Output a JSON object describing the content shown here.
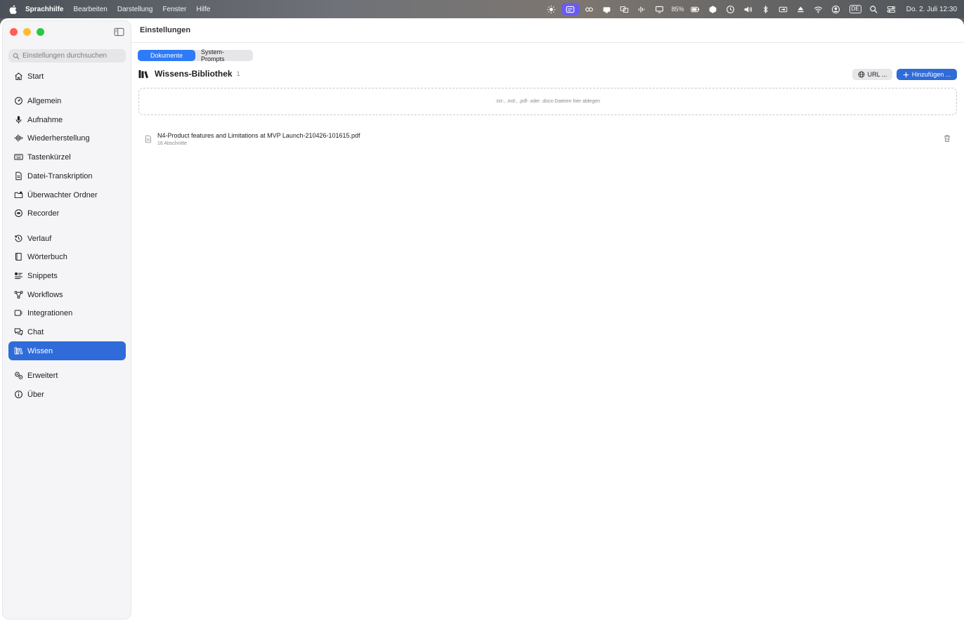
{
  "menubar": {
    "app_name": "Sprachhilfe",
    "menus": [
      "Bearbeiten",
      "Darstellung",
      "Fenster",
      "Hilfe"
    ],
    "battery": "85%",
    "input_source": "DE",
    "clock": "Do. 2. Juli  12:30"
  },
  "window": {
    "title": "Einstellungen"
  },
  "sidebar": {
    "search_placeholder": "Einstellungen durchsuchen",
    "items": [
      {
        "label": "Start",
        "icon": "house-icon"
      },
      {
        "label": "Allgemein",
        "icon": "gauge-icon"
      },
      {
        "label": "Aufnahme",
        "icon": "microphone-icon"
      },
      {
        "label": "Wiederherstellung",
        "icon": "waveform-icon"
      },
      {
        "label": "Tastenkürzel",
        "icon": "keyboard-icon"
      },
      {
        "label": "Datei-Transkription",
        "icon": "document-icon"
      },
      {
        "label": "Überwachter Ordner",
        "icon": "folder-icon"
      },
      {
        "label": "Recorder",
        "icon": "record-icon"
      },
      {
        "label": "Verlauf",
        "icon": "history-icon"
      },
      {
        "label": "Wörterbuch",
        "icon": "book-icon"
      },
      {
        "label": "Snippets",
        "icon": "snippets-icon"
      },
      {
        "label": "Workflows",
        "icon": "workflow-icon"
      },
      {
        "label": "Integrationen",
        "icon": "integration-icon"
      },
      {
        "label": "Chat",
        "icon": "chat-icon"
      },
      {
        "label": "Wissen",
        "icon": "library-icon",
        "active": true
      },
      {
        "label": "Erweitert",
        "icon": "gears-icon"
      },
      {
        "label": "Über",
        "icon": "info-icon"
      }
    ]
  },
  "tabs": {
    "documents": "Dokumente",
    "system_prompts": "System-Prompts"
  },
  "library": {
    "title": "Wissens-Bibliothek",
    "count": "1",
    "url_button": "URL ...",
    "add_button": "Hinzufügen ...",
    "dropzone_text": ".txt-, .md-, .pdf- oder .docx-Dateien hier ablegen",
    "documents": [
      {
        "name": "N4-Product features and Limitations at MVP Launch-210426-101615.pdf",
        "meta": "16 Abschnitte"
      }
    ]
  },
  "colors": {
    "accent": "#2f6bd9",
    "segment_active": "#2f7af6",
    "sidebar_bg": "#f5f5f7"
  }
}
